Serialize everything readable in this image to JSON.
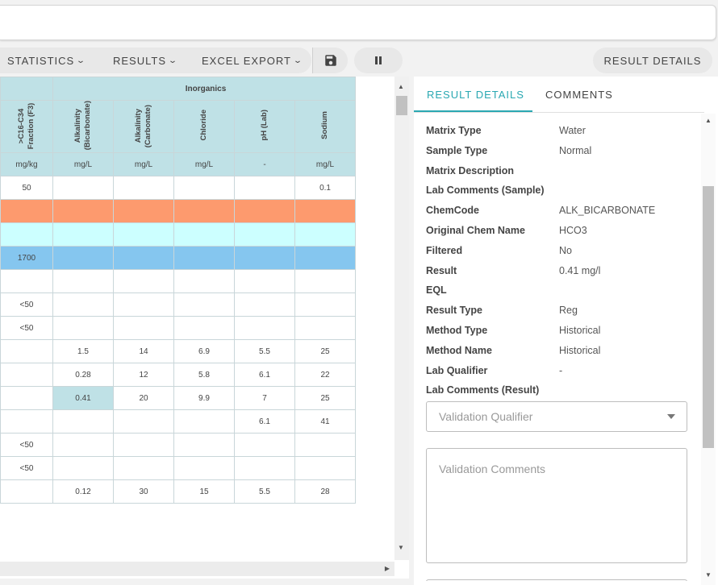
{
  "toolbar": {
    "statistics": "STATISTICS",
    "results": "RESULTS",
    "excel_export": "EXCEL EXPORT",
    "result_details": "RESULT DETAILS"
  },
  "grid": {
    "group_label": "Inorganics",
    "columns": [
      {
        "label": ">C16-C34 Fraction (F3)",
        "unit": "mg/kg"
      },
      {
        "label": "Alkalinity (Bicarbonate)",
        "unit": "mg/L"
      },
      {
        "label": "Alkalinity (Carbonate)",
        "unit": "mg/L"
      },
      {
        "label": "Chloride",
        "unit": "mg/L"
      },
      {
        "label": "pH (Lab)",
        "unit": "-"
      },
      {
        "label": "Sodium",
        "unit": "mg/L"
      }
    ],
    "rows": [
      {
        "style": "white",
        "cells": [
          "50",
          "",
          "",
          "",
          "",
          "0.1"
        ]
      },
      {
        "style": "orange",
        "cells": [
          "",
          "",
          "",
          "",
          "",
          ""
        ]
      },
      {
        "style": "cyan",
        "cells": [
          "",
          "",
          "",
          "",
          "",
          ""
        ]
      },
      {
        "style": "blue",
        "cells": [
          "1700",
          "",
          "",
          "",
          "",
          ""
        ]
      },
      {
        "style": "white",
        "cells": [
          "",
          "",
          "",
          "",
          "",
          ""
        ]
      },
      {
        "style": "white",
        "cells": [
          "<50",
          "",
          "",
          "",
          "",
          ""
        ]
      },
      {
        "style": "white",
        "cells": [
          "<50",
          "",
          "",
          "",
          "",
          ""
        ]
      },
      {
        "style": "white",
        "cells": [
          "",
          "1.5",
          "14",
          "6.9",
          "5.5",
          "25"
        ]
      },
      {
        "style": "white",
        "cells": [
          "",
          "0.28",
          "12",
          "5.8",
          "6.1",
          "22"
        ]
      },
      {
        "style": "white",
        "cells": [
          "",
          "0.41",
          "20",
          "9.9",
          "7",
          "25"
        ],
        "selected": 1
      },
      {
        "style": "white",
        "cells": [
          "",
          "",
          "",
          "",
          "6.1",
          "41"
        ]
      },
      {
        "style": "white",
        "cells": [
          "<50",
          "",
          "",
          "",
          "",
          ""
        ]
      },
      {
        "style": "white",
        "cells": [
          "<50",
          "",
          "",
          "",
          "",
          ""
        ]
      },
      {
        "style": "white",
        "cells": [
          "",
          "0.12",
          "30",
          "15",
          "5.5",
          "28"
        ]
      }
    ]
  },
  "panel": {
    "tabs": [
      "RESULT DETAILS",
      "COMMENTS"
    ],
    "details": [
      {
        "label": "Matrix Type",
        "value": "Water"
      },
      {
        "label": "Sample Type",
        "value": "Normal"
      },
      {
        "label": "Matrix Description",
        "value": ""
      },
      {
        "label": "Lab Comments (Sample)",
        "value": ""
      },
      {
        "label": "ChemCode",
        "value": "ALK_BICARBONATE"
      },
      {
        "label": "Original Chem Name",
        "value": "HCO3"
      },
      {
        "label": "Filtered",
        "value": "No"
      },
      {
        "label": "Result",
        "value": "0.41 mg/l"
      },
      {
        "label": "EQL",
        "value": ""
      },
      {
        "label": "Result Type",
        "value": "Reg"
      },
      {
        "label": "Method Type",
        "value": "Historical"
      },
      {
        "label": "Method Name",
        "value": "Historical"
      },
      {
        "label": "Lab Qualifier",
        "value": "-"
      },
      {
        "label": "Lab Comments (Result)",
        "value": ""
      }
    ],
    "validation_qualifier_placeholder": "Validation Qualifier",
    "validation_comments_placeholder": "Validation Comments"
  }
}
